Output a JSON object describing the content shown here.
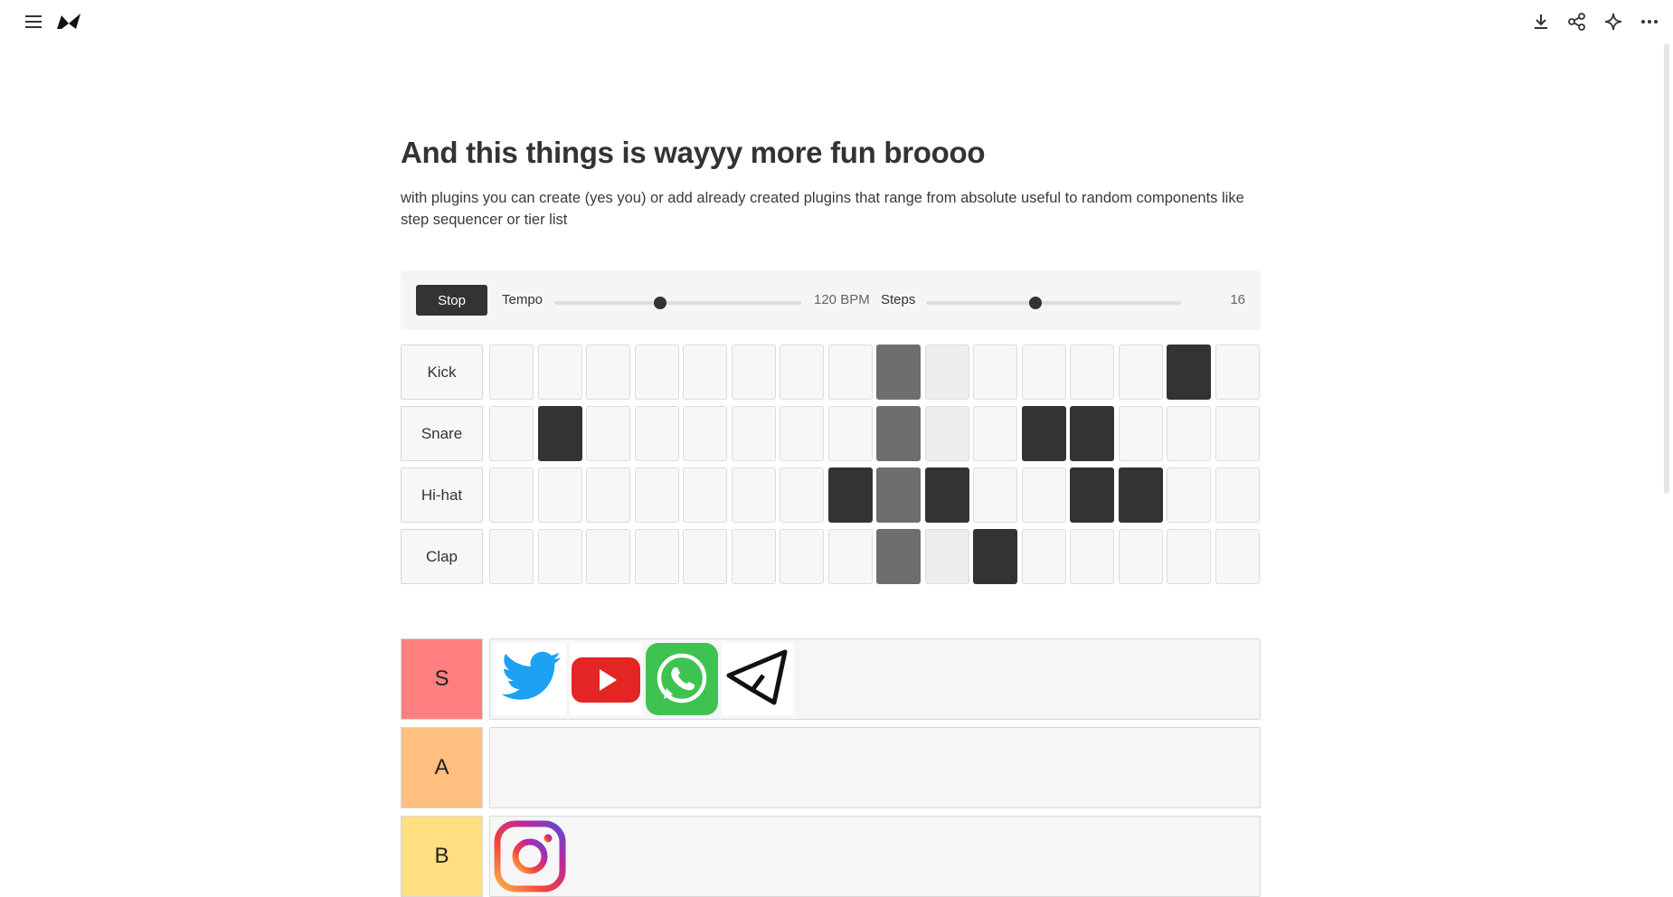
{
  "page": {
    "title": "And this things is wayyy more fun broooo",
    "description": "with plugins you can create (yes you) or add already created plugins that range from absolute useful to random components like step sequencer or tier list"
  },
  "toolbar": {
    "left": [
      "menu-icon",
      "logo-icon"
    ],
    "right": [
      "download-icon",
      "share-icon",
      "sparkle-icon",
      "more-icon"
    ]
  },
  "sequencer": {
    "stop_label": "Stop",
    "tempo_label": "Tempo",
    "tempo_value": "120 BPM",
    "tempo_fraction": 0.43,
    "steps_label": "Steps",
    "steps_value": "16",
    "steps_fraction": 0.43,
    "current_step": 8,
    "tracks": [
      {
        "name": "Kick",
        "steps": [
          0,
          0,
          0,
          0,
          0,
          0,
          0,
          0,
          0,
          0,
          0,
          0,
          0,
          0,
          1,
          0
        ]
      },
      {
        "name": "Snare",
        "steps": [
          0,
          1,
          0,
          0,
          0,
          0,
          0,
          0,
          0,
          0,
          0,
          1,
          1,
          0,
          0,
          0
        ]
      },
      {
        "name": "Hi-hat",
        "steps": [
          0,
          0,
          0,
          0,
          0,
          0,
          0,
          1,
          0,
          1,
          0,
          0,
          1,
          1,
          0,
          0
        ]
      },
      {
        "name": "Clap",
        "steps": [
          0,
          0,
          0,
          0,
          0,
          0,
          0,
          0,
          0,
          0,
          1,
          0,
          0,
          0,
          0,
          0
        ]
      }
    ]
  },
  "tier_list": {
    "tiers": [
      {
        "label": "S",
        "color": "#ff7f7f",
        "items": [
          "twitter-logo",
          "youtube-logo",
          "whatsapp-logo",
          "telegram-logo"
        ]
      },
      {
        "label": "A",
        "color": "#ffbf7f",
        "items": []
      },
      {
        "label": "B",
        "color": "#ffdf80",
        "items": [
          "instagram-logo"
        ]
      }
    ]
  }
}
